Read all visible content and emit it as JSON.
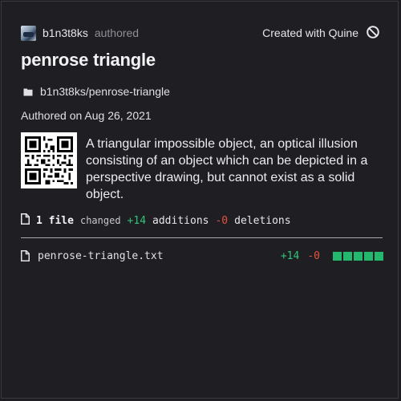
{
  "author": {
    "name": "b1n3t8ks",
    "action": "authored",
    "avatar_icon": "avatar-image"
  },
  "brand": {
    "label": "Created with Quine",
    "icon": "quine-logo-icon"
  },
  "title": "penrose triangle",
  "repo": {
    "icon": "folder-icon",
    "path": "b1n3t8ks/penrose-triangle"
  },
  "authored_on": "Authored on Aug 26, 2021",
  "qr": {
    "icon": "qr-code-icon"
  },
  "description": "A triangular impossible object, an optical illusion consisting of an object which can be depicted in a perspective drawing, but cannot exist as a solid object.",
  "stats": {
    "files": "1 file",
    "changed": "changed",
    "additions_value": "+14",
    "additions_label": "additions",
    "deletions_value": "-0",
    "deletions_label": "deletions"
  },
  "files": [
    {
      "name": "penrose-triangle.txt",
      "additions": "+14",
      "deletions": "-0",
      "change_blocks": 5
    }
  ],
  "colors": {
    "background": "#1f1f23",
    "additions": "#2fc27a",
    "deletions": "#e4523f",
    "change_block": "#23b86e"
  }
}
